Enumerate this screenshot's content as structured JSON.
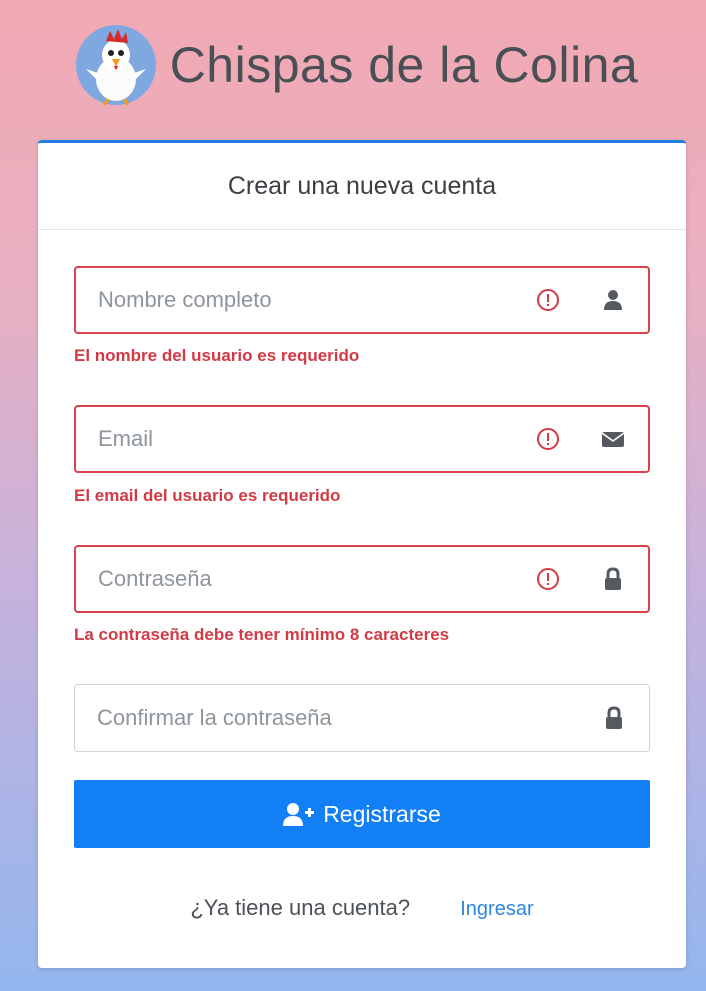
{
  "app": {
    "title": "Chispas de la Colina",
    "logo_icon": "rooster-logo"
  },
  "card": {
    "header": "Crear una nueva cuenta"
  },
  "form": {
    "name": {
      "value": "",
      "placeholder": "Nombre completo",
      "error": "El nombre del usuario es requerido",
      "icon": "user-icon"
    },
    "email": {
      "value": "",
      "placeholder": "Email",
      "error": "El email del usuario es requerido",
      "icon": "envelope-icon"
    },
    "password": {
      "value": "",
      "placeholder": "Contraseña",
      "error": "La contraseña debe tener mínimo 8 caracteres",
      "icon": "lock-icon"
    },
    "confirm_password": {
      "value": "",
      "placeholder": "Confirmar la contraseña",
      "icon": "lock-icon"
    },
    "register_label": "Registrarse",
    "register_icon": "user-plus-icon"
  },
  "footer": {
    "prompt": "¿Ya tiene una cuenta?",
    "login_link": "Ingresar"
  },
  "colors": {
    "accent": "#137ff6",
    "error": "#d23a45",
    "link": "#2e86e0"
  }
}
